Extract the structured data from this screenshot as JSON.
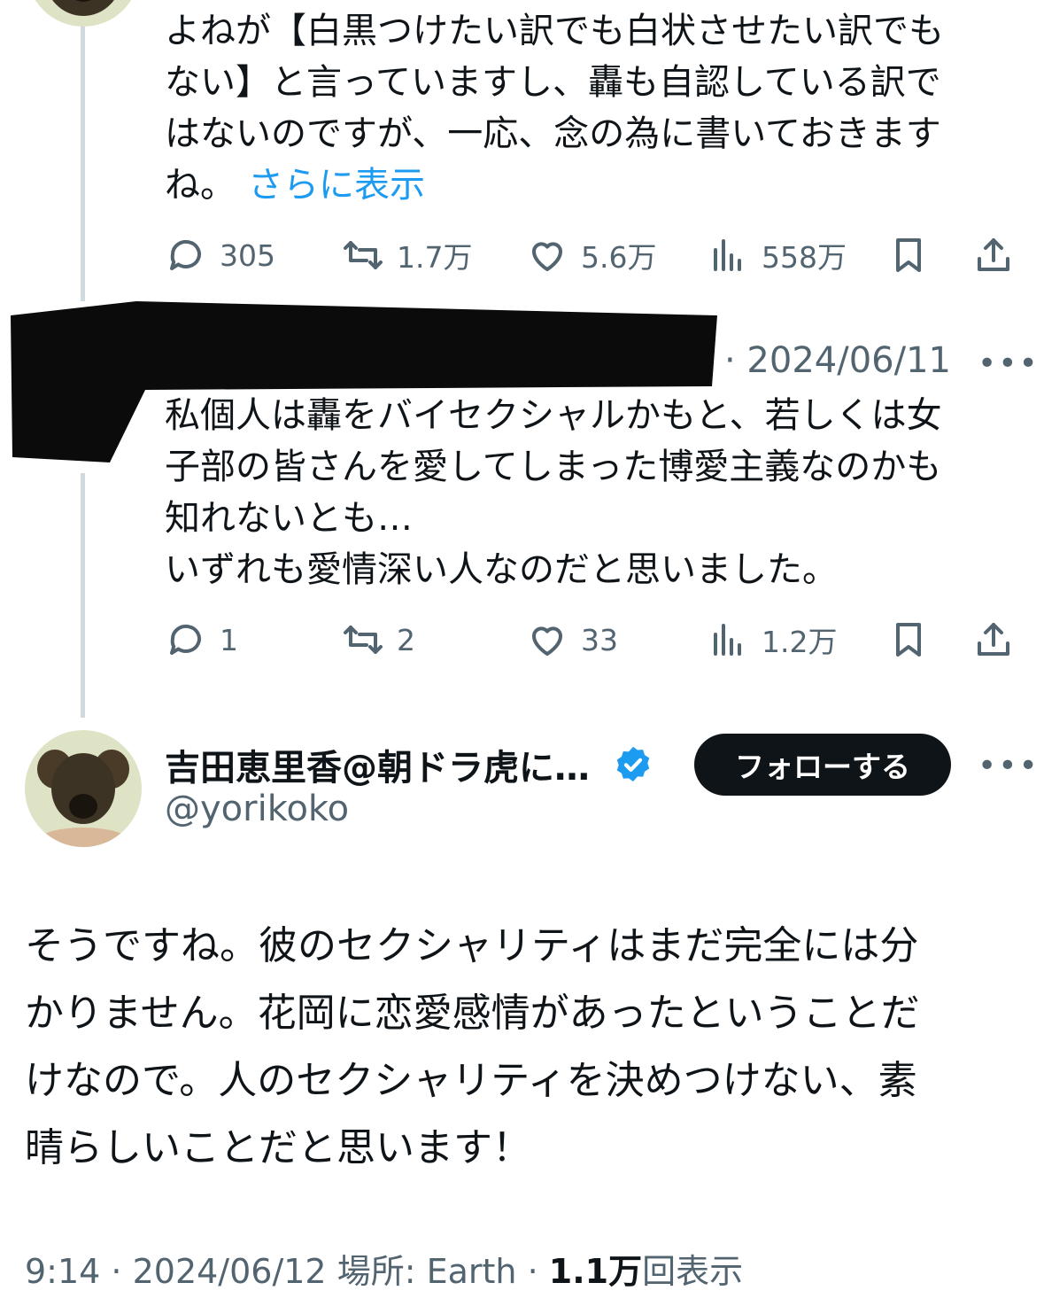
{
  "prev_tweet": {
    "text_lines": [
      "よねが【白黒つけたい訳でも白状させたい訳でも",
      "ない】と言っていますし、轟も自認している訳で",
      "はないのですが、一応、念の為に書いておきます",
      "ね。"
    ],
    "show_more": "さらに表示",
    "stats": {
      "replies": "305",
      "reposts": "1.7万",
      "likes": "5.6万",
      "views": "558万"
    }
  },
  "reply_tweet": {
    "date": "· 2024/06/11",
    "text_lines": [
      "私個人は轟をバイセクシャルかもと、若しくは女",
      "子部の皆さんを愛してしまった博愛主義なのかも",
      "知れないとも…",
      "いずれも愛情深い人なのだと思いました。"
    ],
    "stats": {
      "replies": "1",
      "reposts": "2",
      "likes": "33",
      "views": "1.2万"
    }
  },
  "main_tweet": {
    "author_name": "吉田恵里香@朝ドラ虎に…",
    "handle": "@yorikoko",
    "follow_label": "フォローする",
    "text_lines": [
      "そうですね。彼のセクシャリティはまだ完全には分",
      "かりません。花岡に恋愛感情があったということだ",
      "けなので。人のセクシャリティを決めつけない、素",
      "晴らしいことだと思います！"
    ],
    "meta": {
      "time": "9:14",
      "sep": " · ",
      "date": "2024/06/12",
      "location": "場所: Earth",
      "views_count": "1.1万",
      "views_suffix": "回表示"
    }
  },
  "more_glyph": "•••",
  "colors": {
    "accent": "#1d9bf0",
    "text": "#0f1419",
    "muted": "#536471",
    "line": "#cfd9de"
  }
}
